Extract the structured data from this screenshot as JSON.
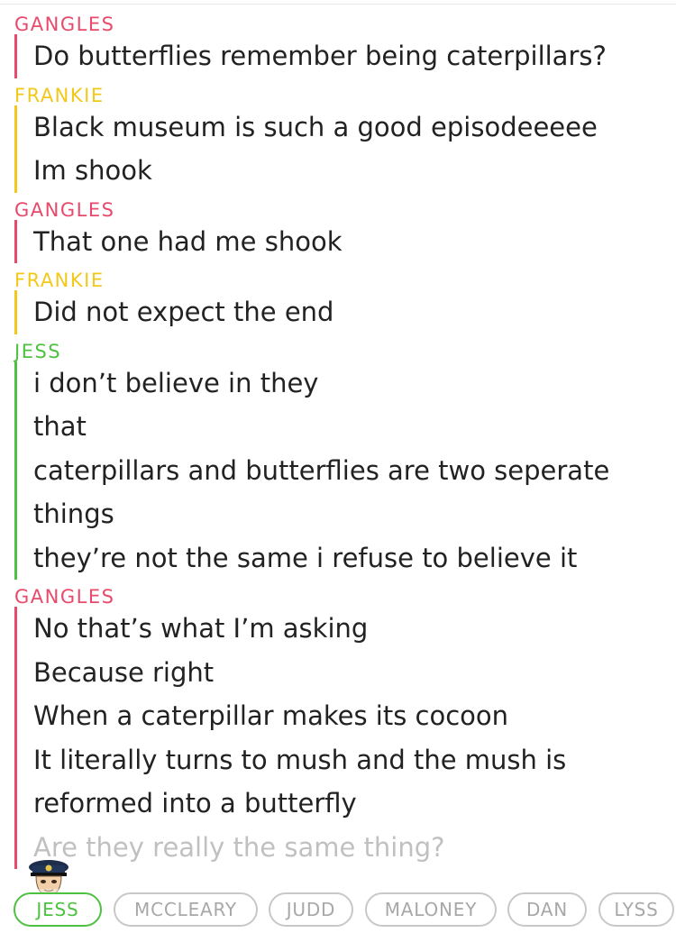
{
  "colors": {
    "gangles": "#e84a6b",
    "frankie": "#f2c81b",
    "jess": "#4fc142",
    "chip_active": "#4fc142",
    "chip_inactive": "#a8a8a8"
  },
  "messages": [
    {
      "sender": "GANGLES",
      "color_key": "gangles",
      "lines": [
        "Do butterflies remember being caterpillars?"
      ]
    },
    {
      "sender": "FRANKIE",
      "color_key": "frankie",
      "lines": [
        "Black museum is such a good episodeeeee",
        "Im shook"
      ]
    },
    {
      "sender": "GANGLES",
      "color_key": "gangles",
      "lines": [
        "That one had me shook"
      ]
    },
    {
      "sender": "FRANKIE",
      "color_key": "frankie",
      "lines": [
        "Did not expect the end"
      ]
    },
    {
      "sender": "JESS",
      "color_key": "jess",
      "lines": [
        "i don’t believe in they",
        "that",
        "caterpillars and butterflies are two seperate",
        "things",
        "they’re not the same i refuse to believe it"
      ]
    },
    {
      "sender": "GANGLES",
      "color_key": "gangles",
      "lines": [
        "No that’s what I’m asking",
        "Because right",
        "When a caterpillar makes its cocoon",
        "It literally turns to mush and the mush is",
        "reformed into a butterfly",
        "Are they really the same thing?"
      ]
    }
  ],
  "friends": [
    {
      "name": "JESS",
      "active": true
    },
    {
      "name": "MCCLEARY",
      "active": false
    },
    {
      "name": "JUDD",
      "active": false
    },
    {
      "name": "MALONEY",
      "active": false
    },
    {
      "name": "DAN",
      "active": false
    },
    {
      "name": "LYSS",
      "active": false
    }
  ],
  "avatar_icon": "bitmoji-police-avatar-icon"
}
